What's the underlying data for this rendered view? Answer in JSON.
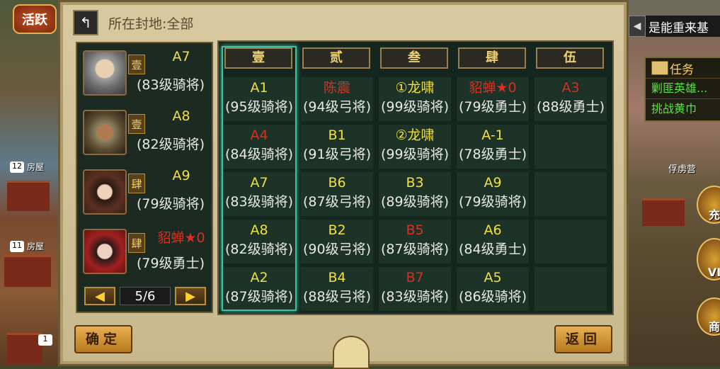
{
  "hud": {
    "activity_label": "活跃",
    "house_label_1": "房屋",
    "house_count_1": "12",
    "house_label_2": "房屋",
    "house_count_2": "11",
    "small_count": "1",
    "marquee_text": "是能重来基",
    "task_title": "任务",
    "task_items": [
      "剿匪英雄...",
      "挑战黄巾"
    ],
    "camp_label": "俘虏营",
    "recharge_label": "充",
    "vip_label": "VI",
    "shop_label": "商"
  },
  "dialog": {
    "header": "所在封地:全部",
    "generals": [
      {
        "name": "A7",
        "name_color": "y",
        "rank": "壹",
        "info": "(83级骑将)"
      },
      {
        "name": "A8",
        "name_color": "y",
        "rank": "壹",
        "info": "(82级骑将)"
      },
      {
        "name": "A9",
        "name_color": "y",
        "rank": "肆",
        "info": "(79级骑将)"
      },
      {
        "name": "貂蝉★0",
        "name_color": "r",
        "rank": "肆",
        "info": "(79级勇士)"
      }
    ],
    "pager": {
      "prev": "◀",
      "label": "5/6",
      "next": "▶"
    },
    "columns": [
      "壹",
      "贰",
      "叁",
      "肆",
      "伍"
    ],
    "grid": [
      [
        {
          "n": "A1",
          "c": "y",
          "i": "(95级骑将)"
        },
        {
          "n": "陈震",
          "c": "r",
          "i": "(94级弓将)"
        },
        {
          "n": "①龙啸",
          "c": "y",
          "i": "(99级骑将)"
        },
        {
          "n": "貂蝉★0",
          "c": "r",
          "i": "(79级勇士)"
        },
        {
          "n": "A3",
          "c": "r",
          "i": "(88级勇士)"
        }
      ],
      [
        {
          "n": "A4",
          "c": "r",
          "i": "(84级骑将)"
        },
        {
          "n": "B1",
          "c": "y",
          "i": "(91级弓将)"
        },
        {
          "n": "②龙啸",
          "c": "y",
          "i": "(99级骑将)"
        },
        {
          "n": "A-1",
          "c": "y",
          "i": "(78级勇士)"
        },
        {
          "n": "",
          "c": "y",
          "i": ""
        }
      ],
      [
        {
          "n": "A7",
          "c": "y",
          "i": "(83级骑将)"
        },
        {
          "n": "B6",
          "c": "y",
          "i": "(87级弓将)"
        },
        {
          "n": "B3",
          "c": "y",
          "i": "(89级骑将)"
        },
        {
          "n": "A9",
          "c": "y",
          "i": "(79级骑将)"
        },
        {
          "n": "",
          "c": "y",
          "i": ""
        }
      ],
      [
        {
          "n": "A8",
          "c": "y",
          "i": "(82级骑将)"
        },
        {
          "n": "B2",
          "c": "y",
          "i": "(90级弓将)"
        },
        {
          "n": "B5",
          "c": "r",
          "i": "(87级骑将)"
        },
        {
          "n": "A6",
          "c": "y",
          "i": "(84级勇士)"
        },
        {
          "n": "",
          "c": "y",
          "i": ""
        }
      ],
      [
        {
          "n": "A2",
          "c": "y",
          "i": "(87级骑将)"
        },
        {
          "n": "B4",
          "c": "y",
          "i": "(88级弓将)"
        },
        {
          "n": "B7",
          "c": "r",
          "i": "(83级骑将)"
        },
        {
          "n": "A5",
          "c": "y",
          "i": "(86级骑将)"
        },
        {
          "n": "",
          "c": "y",
          "i": ""
        }
      ]
    ],
    "confirm_label": "确定",
    "back_label": "返回"
  }
}
